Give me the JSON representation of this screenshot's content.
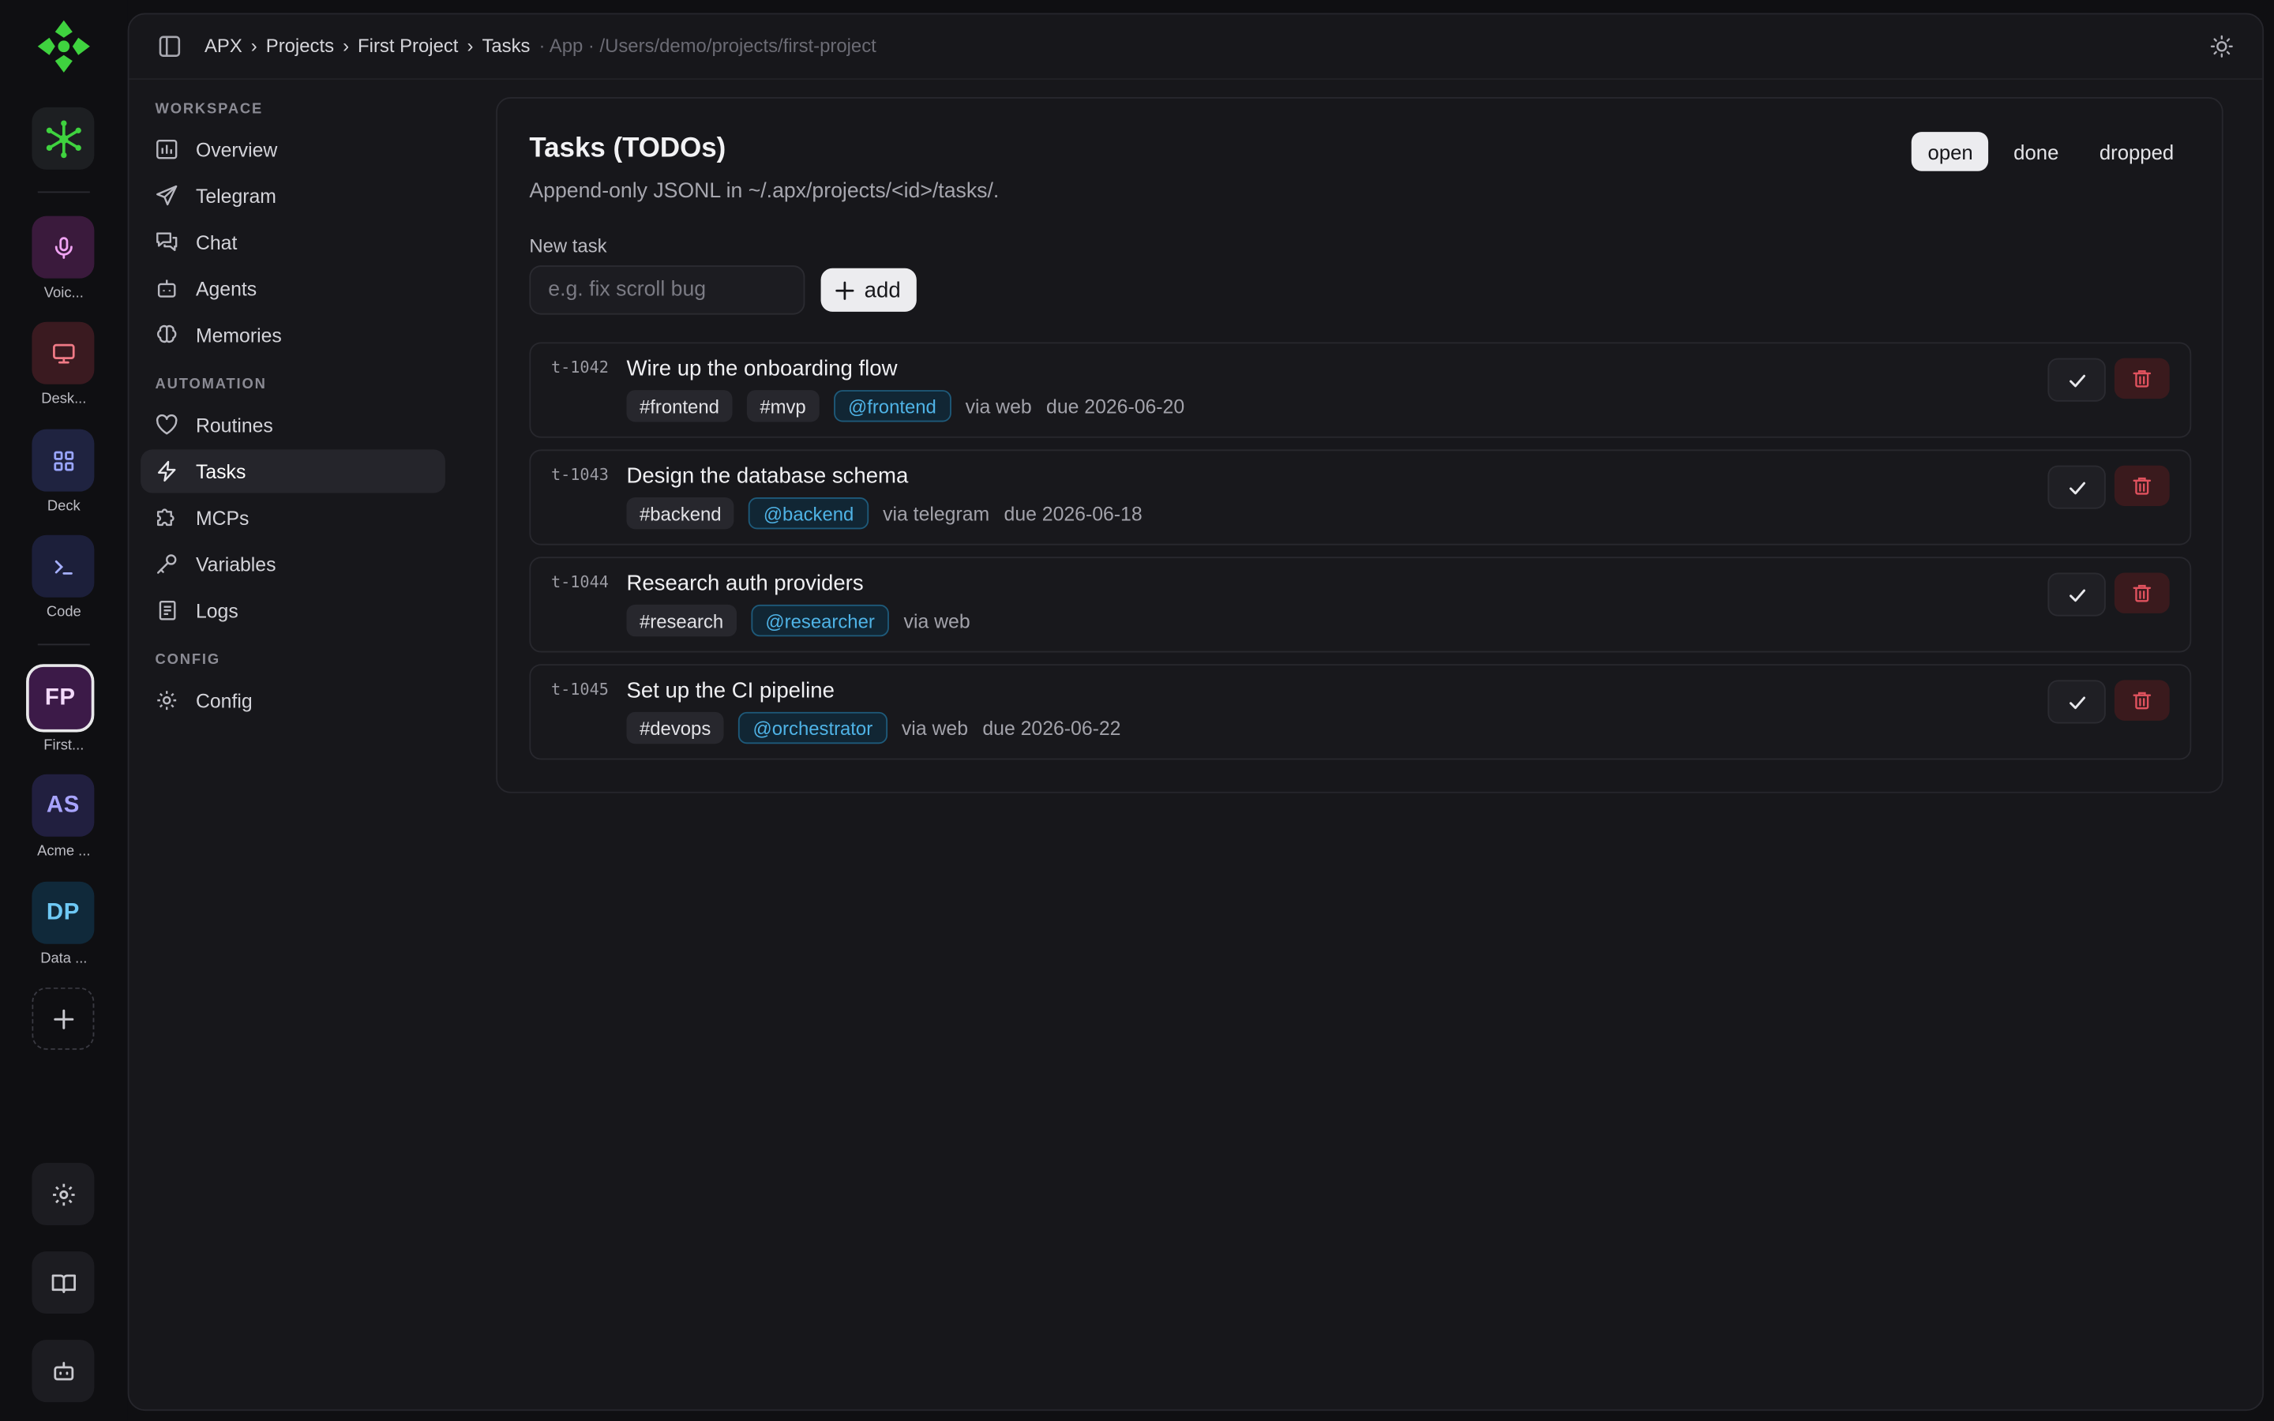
{
  "rail": {
    "items": [
      {
        "label": "Voic...",
        "icon": "microphone-icon",
        "bg": "#3a1a3c",
        "fg": "#f0a3f3"
      },
      {
        "label": "Desk...",
        "icon": "monitor-icon",
        "bg": "#3a1a20",
        "fg": "#f07a86"
      },
      {
        "label": "Deck",
        "icon": "grid-icon",
        "bg": "#1f2340",
        "fg": "#9aa6ff"
      },
      {
        "label": "Code",
        "icon": "terminal-icon",
        "bg": "#1c1f3a",
        "fg": "#a6b0ff"
      }
    ],
    "projects": [
      {
        "initials": "FP",
        "label": "First...",
        "bg": "#3c1a48",
        "fg": "#f3d9fb"
      },
      {
        "initials": "AS",
        "label": "Acme ...",
        "bg": "#211f3f",
        "fg": "#a8a4ff"
      },
      {
        "initials": "DP",
        "label": "Data ...",
        "bg": "#10293a",
        "fg": "#6ec8f4"
      }
    ]
  },
  "breadcrumb": {
    "apx": "APX",
    "sep": "›",
    "projects": "Projects",
    "project": "First Project",
    "tasks": "Tasks",
    "suffix": "· App · /Users/demo/projects/first-project"
  },
  "nav": {
    "workspace_heading": "WORKSPACE",
    "workspace": [
      "Overview",
      "Telegram",
      "Chat",
      "Agents",
      "Memories"
    ],
    "automation_heading": "AUTOMATION",
    "automation": [
      "Routines",
      "Tasks",
      "MCPs",
      "Variables",
      "Logs"
    ],
    "config_heading": "CONFIG",
    "config": [
      "Config"
    ]
  },
  "card": {
    "title": "Tasks (TODOs)",
    "subtitle": "Append-only JSONL in ~/.apx/projects/<id>/tasks/.",
    "filters": [
      "open",
      "done",
      "dropped"
    ],
    "new_label": "New task",
    "new_placeholder": "e.g. fix scroll bug",
    "add_label": "add"
  },
  "tasks": [
    {
      "id": "t-1042",
      "title": "Wire up the onboarding flow",
      "tags": [
        "#frontend",
        "#mvp"
      ],
      "assignee": "@frontend",
      "via": "via web",
      "due": "due 2026-06-20"
    },
    {
      "id": "t-1043",
      "title": "Design the database schema",
      "tags": [
        "#backend"
      ],
      "assignee": "@backend",
      "via": "via telegram",
      "due": "due 2026-06-18"
    },
    {
      "id": "t-1044",
      "title": "Research auth providers",
      "tags": [
        "#research"
      ],
      "assignee": "@researcher",
      "via": "via web",
      "due": ""
    },
    {
      "id": "t-1045",
      "title": "Set up the CI pipeline",
      "tags": [
        "#devops"
      ],
      "assignee": "@orchestrator",
      "via": "via web",
      "due": "due 2026-06-22"
    }
  ]
}
